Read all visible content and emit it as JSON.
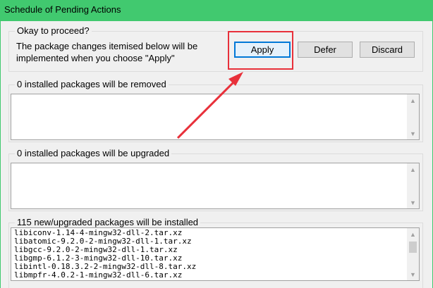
{
  "window": {
    "title": "Schedule of Pending Actions"
  },
  "proceed": {
    "label": "Okay to proceed?",
    "description": "The package changes itemised below will be implemented when you choose \"Apply\"",
    "buttons": {
      "apply": "Apply",
      "defer": "Defer",
      "discard": "Discard"
    }
  },
  "removed": {
    "label": "0 installed packages will be removed"
  },
  "upgraded": {
    "label": "0 installed packages will be upgraded"
  },
  "installed": {
    "label": "115 new/upgraded packages will be installed",
    "packages": [
      "libiconv-1.14-4-mingw32-dll-2.tar.xz",
      "libatomic-9.2.0-2-mingw32-dll-1.tar.xz",
      "libgcc-9.2.0-2-mingw32-dll-1.tar.xz",
      "libgmp-6.1.2-3-mingw32-dll-10.tar.xz",
      "libintl-0.18.3.2-2-mingw32-dll-8.tar.xz",
      "libmpfr-4.0.2-1-mingw32-dll-6.tar.xz"
    ]
  },
  "colors": {
    "titlebar": "#41c96f",
    "highlight": "#e8303a",
    "default_button_border": "#0078d7"
  }
}
